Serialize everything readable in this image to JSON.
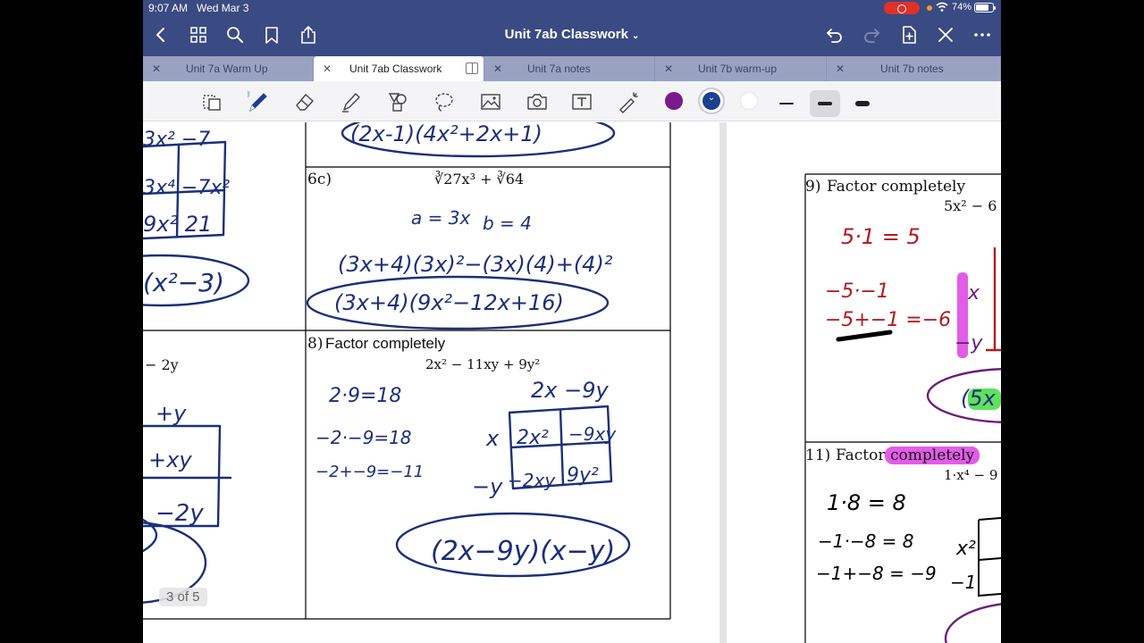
{
  "status_bar": {
    "time": "9:07 AM",
    "date": "Wed Mar 3",
    "battery": "74%"
  },
  "nav": {
    "title": "Unit 7ab Classwork"
  },
  "tabs": [
    {
      "label": "Unit 7a Warm Up",
      "active": false
    },
    {
      "label": "Unit 7ab Classwork",
      "active": true
    },
    {
      "label": "Unit 7a notes",
      "active": false
    },
    {
      "label": "Unit 7b warm-up",
      "active": false
    },
    {
      "label": "Unit 7b notes",
      "active": false
    }
  ],
  "toolbar": {
    "tools": [
      "lasso-pages-icon",
      "pen-icon",
      "eraser-icon",
      "highlighter-icon",
      "shapes-icon",
      "lasso-icon",
      "image-icon",
      "camera-icon",
      "text-box-icon",
      "laser-pointer-icon"
    ],
    "colors": [
      "#7a1a8c",
      "#1c3f8f",
      "#ffffff"
    ],
    "selected_color": "#1c3f8f"
  },
  "page": {
    "indicator": "3 of 5",
    "problems": {
      "p6c": {
        "number": "6c)",
        "expr": "∛27x³ + ∛64"
      },
      "p8": {
        "number": "8)",
        "prompt": "Factor completely",
        "expr": "2x² − 11xy + 9y²"
      },
      "p9": {
        "number": "9)",
        "prompt": "Factor completely",
        "expr": "5x² − 6"
      },
      "p11": {
        "number": "11)",
        "prompt_plain": "Factor",
        "prompt_highlight": "completely",
        "expr": "1·x⁴ − 9"
      }
    },
    "left_partial": {
      "expr": "− 2y"
    }
  },
  "colors": {
    "nav_bg": "#3a4a82",
    "tab_bg": "#9aa2c2",
    "ink_blue": "#1c2f7a",
    "ink_red": "#b01c22",
    "ink_purple": "#6a1f7a",
    "highlight_pink": "#e35ce8",
    "highlight_green": "#5fe25f"
  }
}
